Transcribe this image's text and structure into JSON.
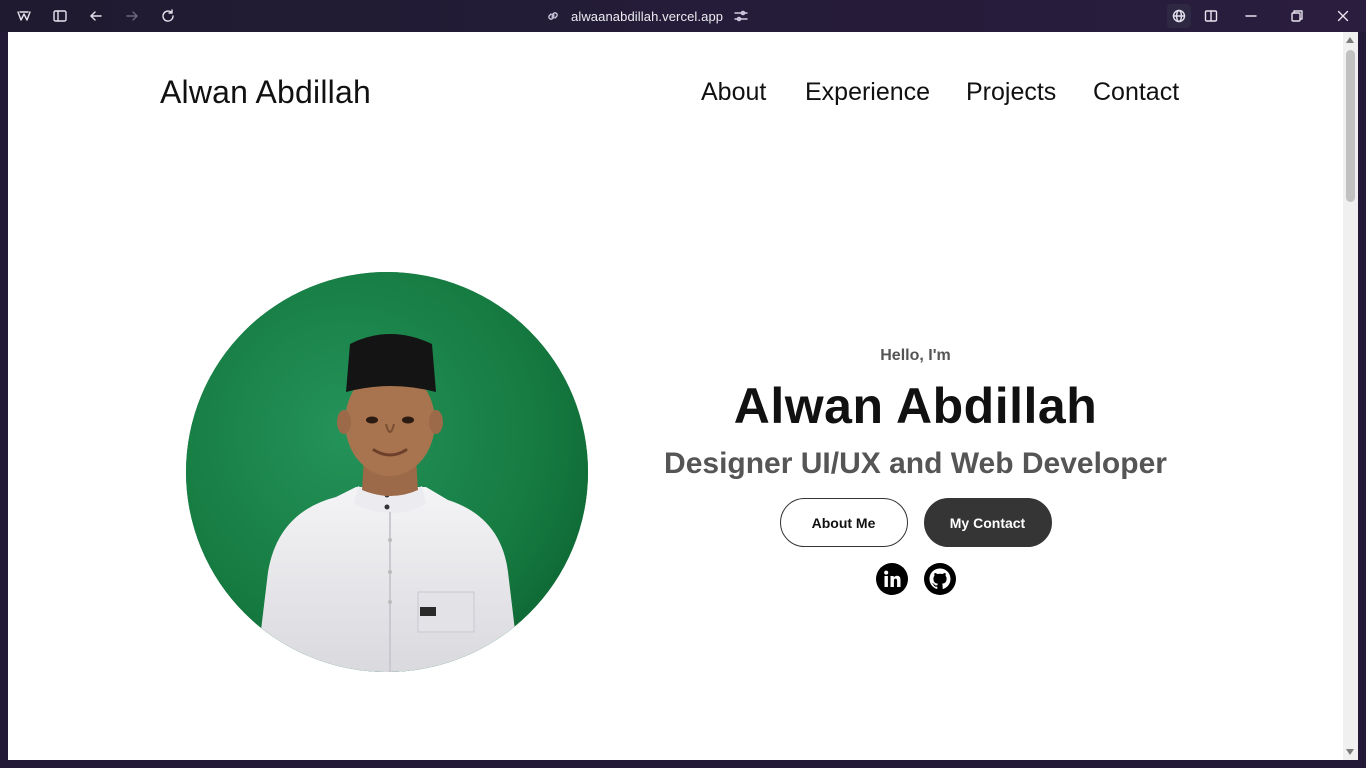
{
  "browser": {
    "url": "alwaanabdillah.vercel.app",
    "icons": {
      "app": "app-menu-icon",
      "sidebar": "sidebar-icon",
      "back": "back-arrow-icon",
      "forward": "forward-arrow-icon",
      "reload": "reload-icon",
      "link": "link-icon",
      "tune": "tune-icon",
      "globe": "globe-icon",
      "split": "split-view-icon",
      "minimize": "minimize-icon",
      "restore": "restore-icon",
      "close": "close-icon"
    }
  },
  "header": {
    "brand": "Alwan Abdillah",
    "nav": {
      "about": "About",
      "experience": "Experience",
      "projects": "Projects",
      "contact": "Contact"
    }
  },
  "hero": {
    "greeting": "Hello, I'm",
    "name": "Alwan Abdillah",
    "role": "Designer UI/UX and Web Developer",
    "buttons": {
      "about": "About Me",
      "contact": "My Contact"
    },
    "socials": {
      "linkedin": "linkedin-icon",
      "github": "github-icon"
    }
  },
  "colors": {
    "chrome_bg": "#221a36",
    "page_bg": "#ffffff",
    "text_primary": "#111111",
    "text_secondary": "#555555",
    "button_dark": "#353535",
    "avatar_bg": "#167a40"
  }
}
